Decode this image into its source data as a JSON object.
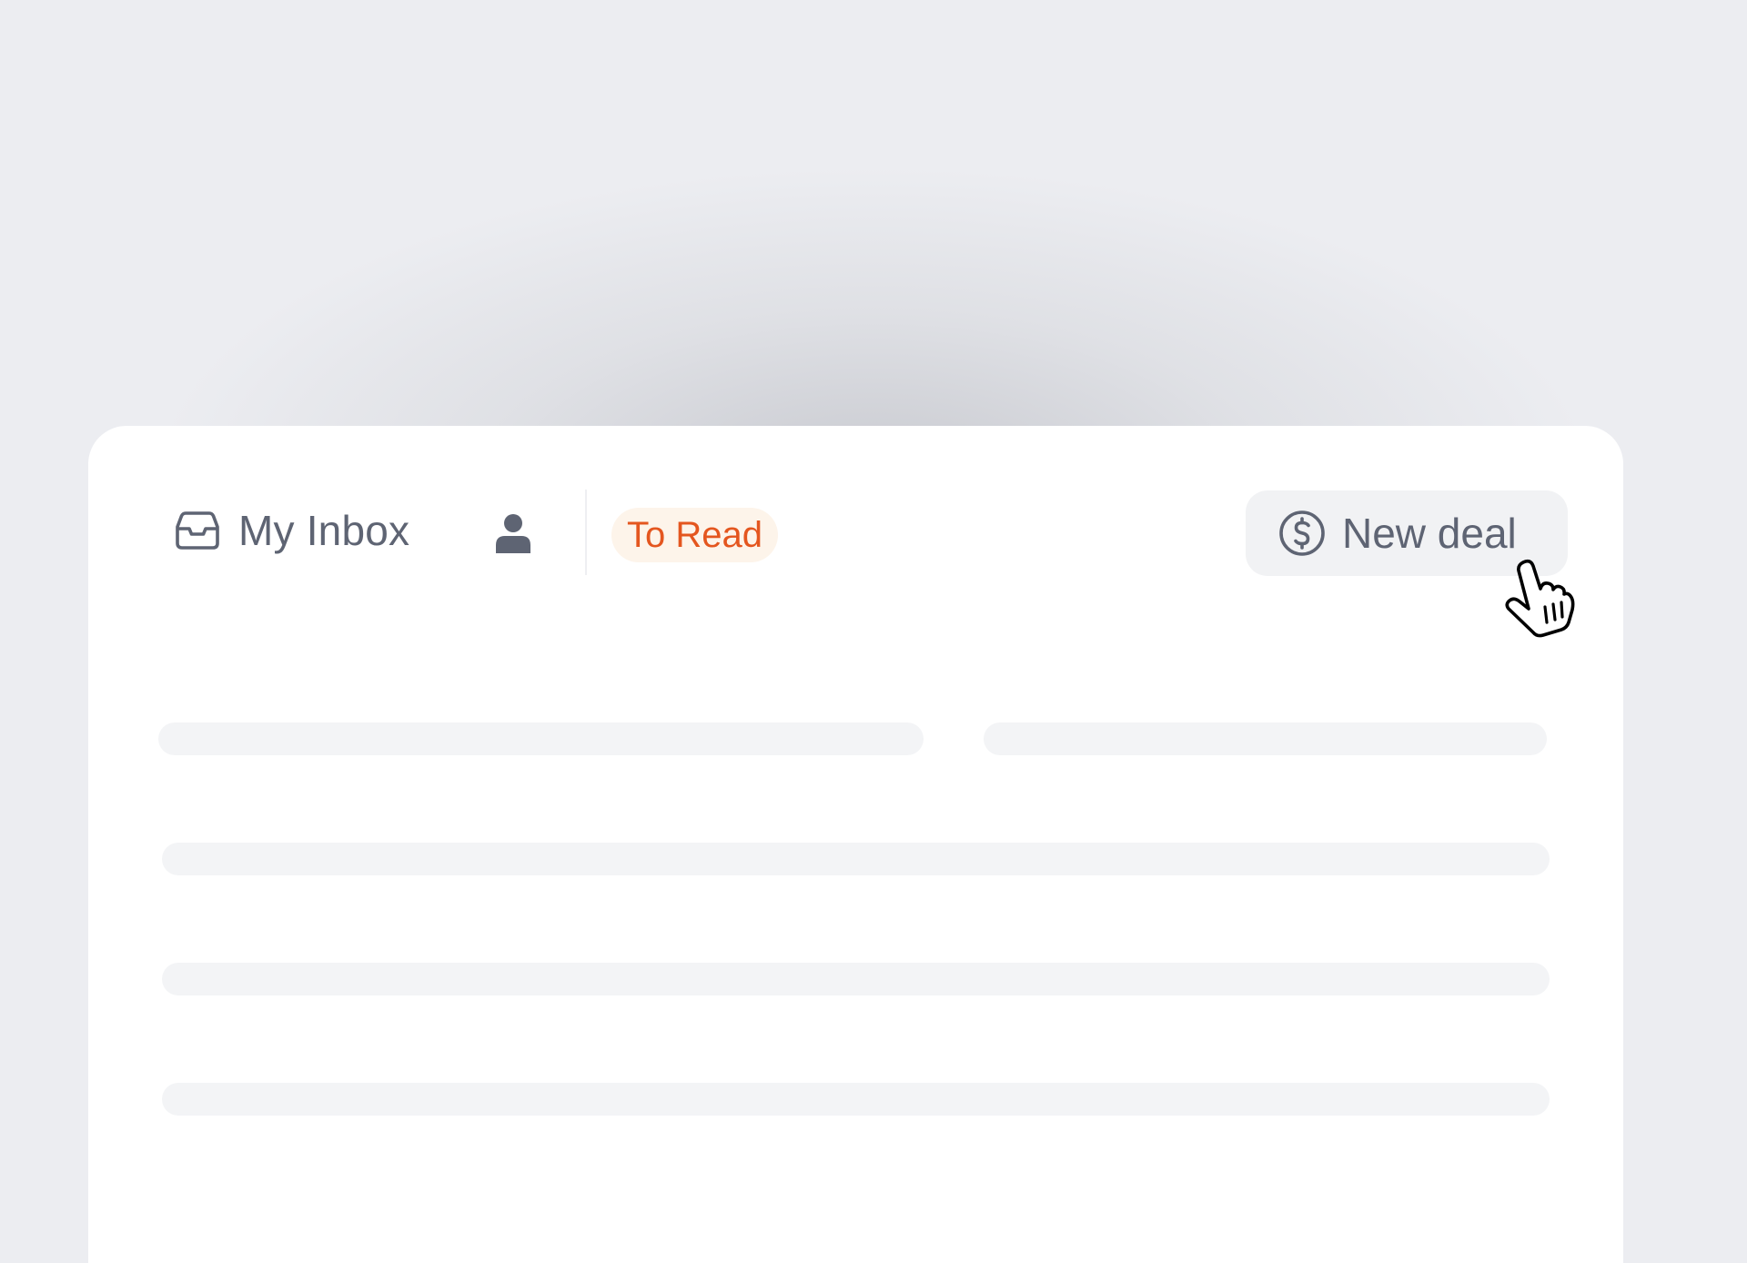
{
  "toolbar": {
    "inbox_label": "My Inbox",
    "inbox_icon": "inbox-tray-icon",
    "user_icon": "user-icon",
    "badge_label": "To Read",
    "new_deal_label": "New deal",
    "new_deal_icon": "dollar-circle-icon"
  },
  "cursor": {
    "icon": "pointer-hand-icon"
  },
  "colors": {
    "background": "#ECEDF1",
    "card": "#FFFFFF",
    "text": "#5E6473",
    "badge_text": "#E4561F",
    "badge_bg": "#FDF4EA",
    "button_bg": "#F1F2F4",
    "skeleton": "#F3F4F6"
  }
}
